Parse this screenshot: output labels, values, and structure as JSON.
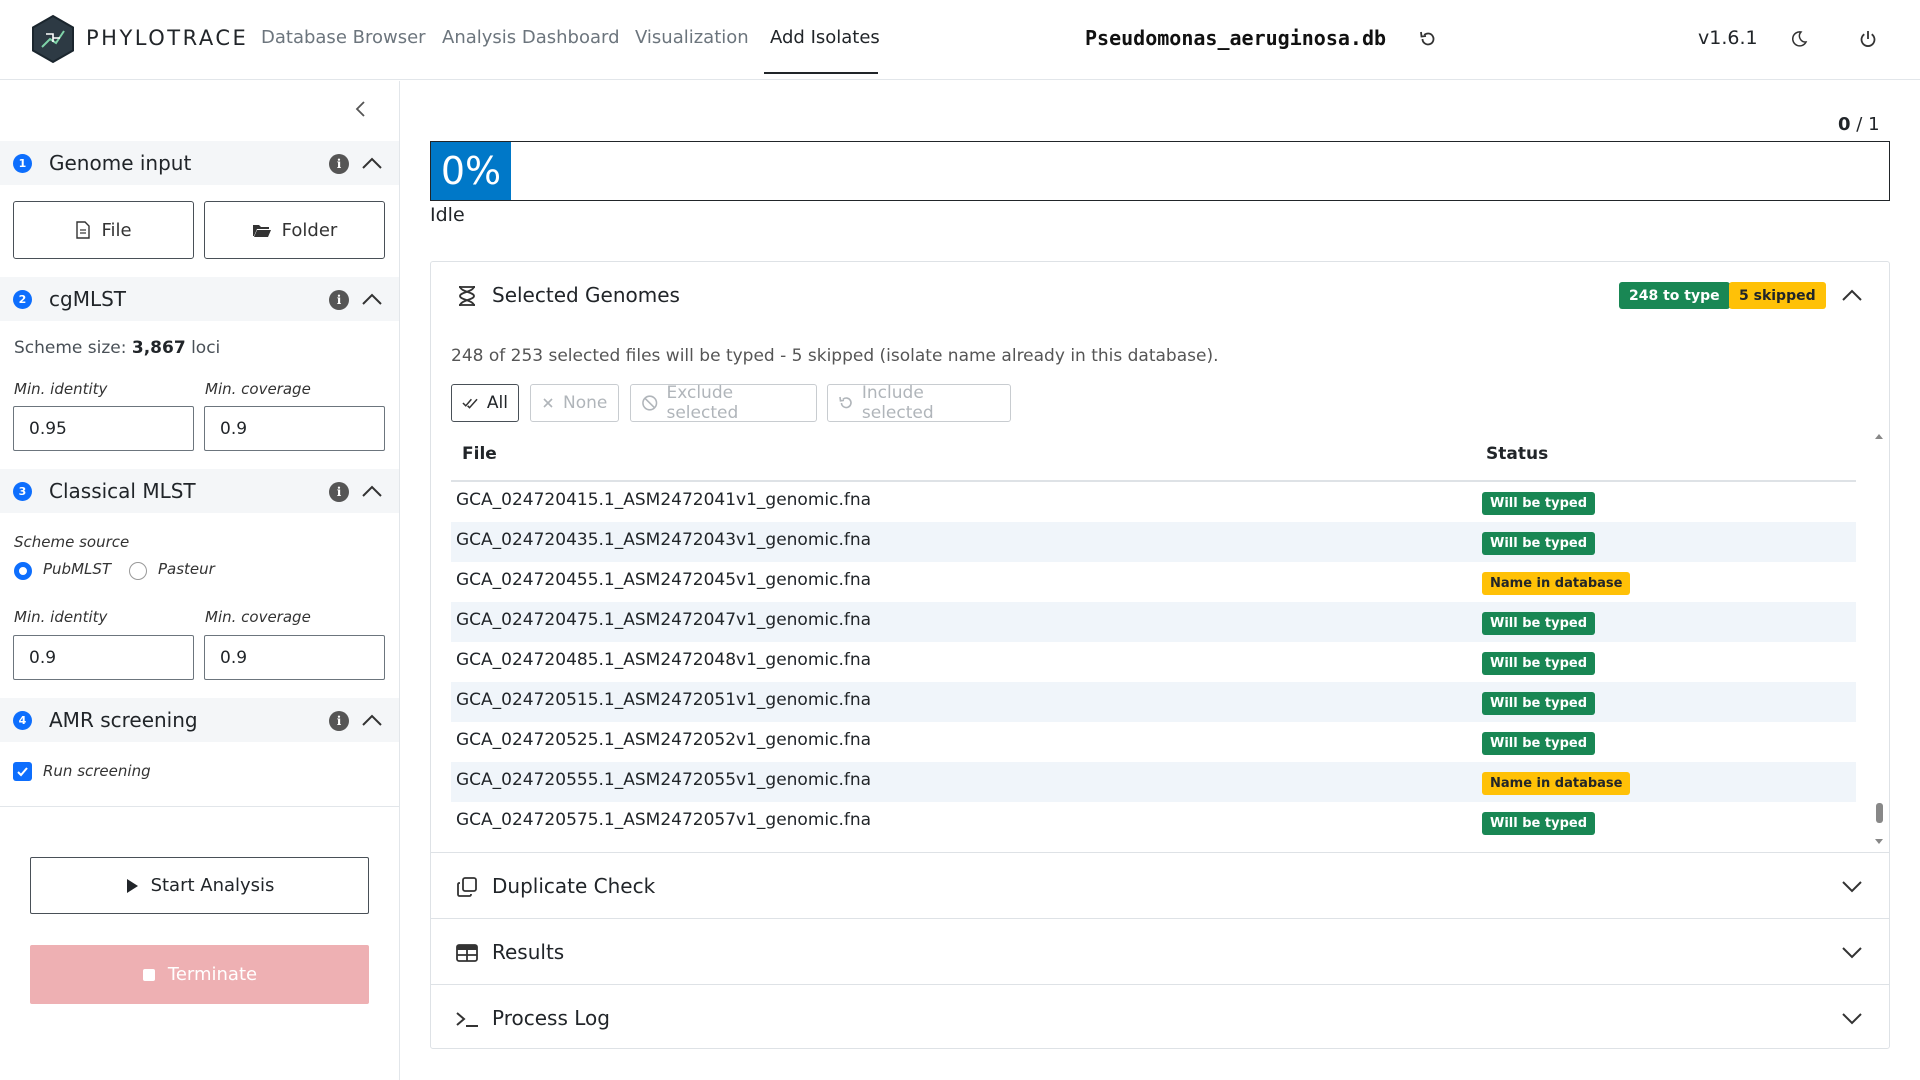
{
  "header": {
    "brand": "PHYLOTRACE",
    "tabs": [
      {
        "label": "Database Browser"
      },
      {
        "label": "Analysis Dashboard"
      },
      {
        "label": "Visualization"
      },
      {
        "label": "Add Isolates"
      }
    ],
    "active_tab": "Add Isolates",
    "database": "Pseudomonas_aeruginosa.db",
    "version": "v1.6.1",
    "icons": [
      "reload-icon",
      "moon-icon",
      "power-icon"
    ]
  },
  "sidebar": {
    "genome_input": {
      "step": "1",
      "title": "Genome input",
      "file_label": "File",
      "folder_label": "Folder"
    },
    "cgmlst": {
      "step": "2",
      "title": "cgMLST",
      "scheme_size_label": "Scheme size:",
      "scheme_size_value": "3,867",
      "scheme_size_unit": "loci",
      "min_identity_label": "Min. identity",
      "min_identity": "0.95",
      "min_coverage_label": "Min. coverage",
      "min_coverage": "0.9"
    },
    "classical_mlst": {
      "step": "3",
      "title": "Classical MLST",
      "scheme_source_label": "Scheme source",
      "options": [
        "PubMLST",
        "Pasteur"
      ],
      "selected": "PubMLST",
      "min_identity_label": "Min. identity",
      "min_identity": "0.9",
      "min_coverage_label": "Min. coverage",
      "min_coverage": "0.9"
    },
    "amr": {
      "step": "4",
      "title": "AMR screening",
      "run_label": "Run screening",
      "run_checked": true
    },
    "start_label": "Start Analysis",
    "terminate_label": "Terminate"
  },
  "progress": {
    "done": "0",
    "separator": "/",
    "total": "1",
    "percent_label": "0%",
    "percent": 0,
    "status": "Idle"
  },
  "selected_genomes": {
    "title": "Selected Genomes",
    "badge_to_type": "248 to type",
    "badge_skipped": "5 skipped",
    "summary": "248 of 253 selected files will be typed - 5 skipped (isolate name already in this database).",
    "buttons": {
      "all": "All",
      "none": "None",
      "exclude": "Exclude selected",
      "include": "Include selected"
    },
    "columns": [
      "File",
      "Status"
    ],
    "rows": [
      {
        "file": "GCA_024720415.1_ASM2472041v1_genomic.fna",
        "status": "Will be typed"
      },
      {
        "file": "GCA_024720435.1_ASM2472043v1_genomic.fna",
        "status": "Will be typed"
      },
      {
        "file": "GCA_024720455.1_ASM2472045v1_genomic.fna",
        "status": "Name in database"
      },
      {
        "file": "GCA_024720475.1_ASM2472047v1_genomic.fna",
        "status": "Will be typed"
      },
      {
        "file": "GCA_024720485.1_ASM2472048v1_genomic.fna",
        "status": "Will be typed"
      },
      {
        "file": "GCA_024720515.1_ASM2472051v1_genomic.fna",
        "status": "Will be typed"
      },
      {
        "file": "GCA_024720525.1_ASM2472052v1_genomic.fna",
        "status": "Will be typed"
      },
      {
        "file": "GCA_024720555.1_ASM2472055v1_genomic.fna",
        "status": "Name in database"
      },
      {
        "file": "GCA_024720575.1_ASM2472057v1_genomic.fna",
        "status": "Will be typed"
      }
    ]
  },
  "panels": {
    "duplicate_check": "Duplicate Check",
    "results": "Results",
    "process_log": "Process Log"
  },
  "colors": {
    "accent": "#0d6efd",
    "progress": "#0078c8",
    "success": "#198754",
    "warning": "#ffc107",
    "terminate_disabled": "#eeb0b3"
  }
}
